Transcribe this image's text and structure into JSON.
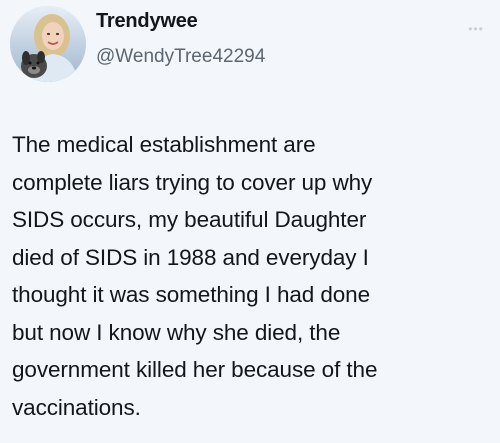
{
  "tweet": {
    "display_name": "Trendywee",
    "handle": "@WendyTree42294",
    "more_icon": "more-dots-icon",
    "avatar_icon": "profile-photo",
    "lines": [
      "The medical establishment are",
      "complete liars trying to cover up why",
      "SIDS occurs, my beautiful Daughter",
      "died of SIDS in 1988 and everyday I",
      "thought it was something I had done",
      "but now I know why she died, the",
      "government killed her because of the",
      "vaccinations."
    ]
  }
}
